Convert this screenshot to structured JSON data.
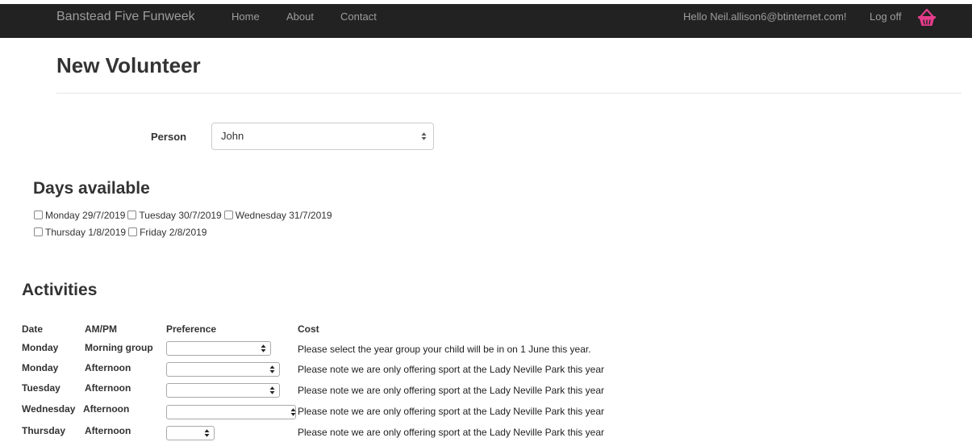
{
  "nav": {
    "brand": "Banstead Five Funweek",
    "home": "Home",
    "about": "About",
    "contact": "Contact",
    "greeting": "Hello Neil.allison6@btinternet.com!",
    "logoff": "Log off"
  },
  "colors": {
    "navbar": "#222222",
    "basket": "#e63c8c"
  },
  "page": {
    "title": "New Volunteer"
  },
  "person": {
    "label": "Person",
    "selected": "John"
  },
  "days": {
    "title": "Days available",
    "items": [
      "Monday 29/7/2019",
      "Tuesday 30/7/2019",
      "Wednesday 31/7/2019",
      "Thursday 1/8/2019",
      "Friday 2/8/2019"
    ]
  },
  "activities": {
    "title": "Activities",
    "headers": {
      "date": "Date",
      "ampm": "AM/PM",
      "preference": "Preference",
      "cost": "Cost"
    },
    "rows": [
      {
        "date": "Monday",
        "ampm": "Morning group",
        "cost": "Please select the year group your child will be in on 1 June this year."
      },
      {
        "date": "Monday",
        "ampm": "Afternoon",
        "cost": "Please note we are only offering sport at the Lady Neville Park this year"
      },
      {
        "date": "Tuesday",
        "ampm": "Afternoon",
        "cost": "Please note we are only offering sport at the Lady Neville Park this year"
      },
      {
        "date": "Wednesday",
        "ampm": "Afternoon",
        "cost": "Please note we are only offering sport at the Lady Neville Park this year"
      },
      {
        "date": "Thursday",
        "ampm": "Afternoon",
        "cost": "Please note we are only offering sport at the Lady Neville Park this year"
      }
    ]
  }
}
